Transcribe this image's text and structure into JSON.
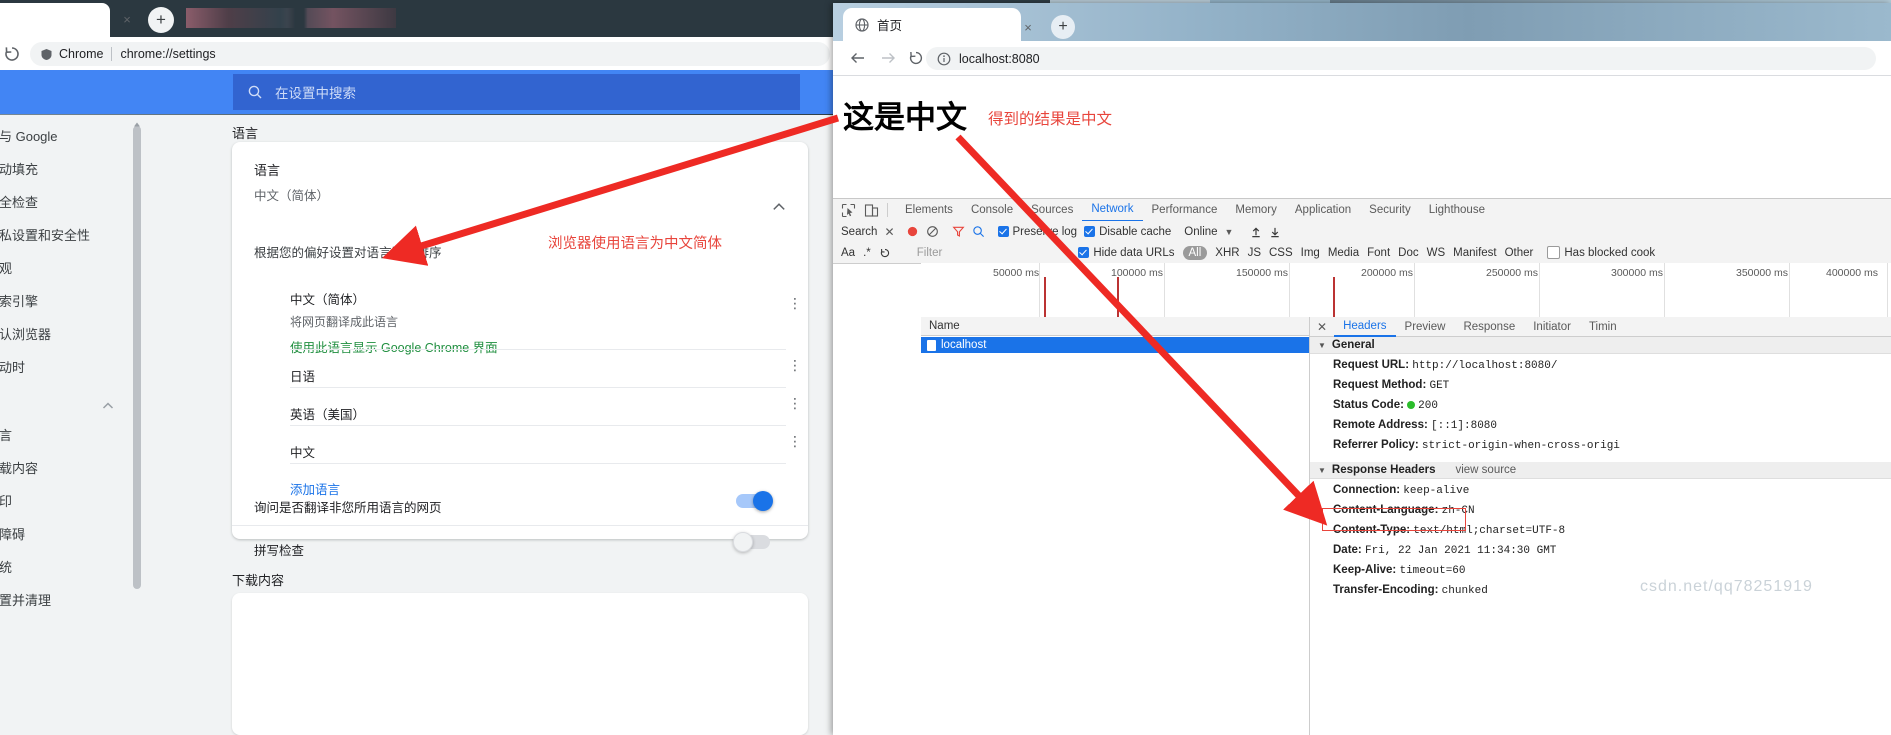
{
  "window_settings": {
    "tab": {
      "close_label": "×",
      "newtab_label": "+"
    },
    "toolbar": {
      "reload_icon": "reload-icon",
      "chip_label": "Chrome",
      "url": "chrome://settings"
    },
    "search": {
      "placeholder": "在设置中搜索",
      "icon": "search-icon"
    },
    "sidebar": {
      "items": [
        "您与 Google",
        "自动填充",
        "安全检查",
        "隐私设置和安全性",
        "外观",
        "搜索引擎",
        "默认浏览器",
        "启动时",
        "语言",
        "下载内容",
        "打印",
        "无障碍",
        "系统",
        "重置并清理"
      ]
    },
    "content": {
      "section_title": "语言",
      "section_title2": "下载内容",
      "card": {
        "title": "语言",
        "subtitle": "中文（简体）",
        "order_hint": "根据您的偏好设置对语言进行排序",
        "languages": [
          {
            "name": "中文（简体）",
            "sub": "将网页翻译成此语言",
            "alt": "使用此语言显示 Google Chrome 界面"
          },
          {
            "name": "日语",
            "sub": "",
            "alt": ""
          },
          {
            "name": "英语（美国）",
            "sub": "",
            "alt": ""
          },
          {
            "name": "中文",
            "sub": "",
            "alt": ""
          }
        ],
        "add_language": "添加语言",
        "translate_row": "询问是否翻译非您所用语言的网页",
        "spellcheck_row": "拼写检查",
        "translate_toggle": "on",
        "spellcheck_toggle": "off",
        "menu_icon": "kebab-menu-icon",
        "collapse_icon": "chevron-up-icon"
      }
    },
    "annotation": "浏览器使用语言为中文简体"
  },
  "window_devtools": {
    "tab": {
      "title": "首页",
      "favicon": "globe-icon",
      "close_label": "×",
      "newtab_label": "+"
    },
    "toolbar": {
      "back_icon": "arrow-left-icon",
      "forward_icon": "arrow-right-icon",
      "reload_icon": "reload-icon",
      "info_icon": "info-circle-icon",
      "url": "localhost:8080"
    },
    "page": {
      "heading": "这是中文",
      "annotation": "得到的结果是中文"
    },
    "devtools": {
      "inspect_icon": "cursor-inspect-icon",
      "device_icon": "device-toolbar-icon",
      "tabs": [
        "Elements",
        "Console",
        "Sources",
        "Network",
        "Performance",
        "Memory",
        "Application",
        "Security",
        "Lighthouse"
      ],
      "active_tab": "Network",
      "toolbar": {
        "search_label": "Search",
        "clear_label": "✕",
        "record_icon": "record-circle-icon",
        "clear_icon": "no-entry-icon",
        "filter_icon": "funnel-icon",
        "search_icon": "search-icon",
        "preserve_log": "Preserve log",
        "disable_cache": "Disable cache",
        "throttle": "Online",
        "import_icon": "import-arrow-icon",
        "export_icon": "export-arrow-icon"
      },
      "filterbar": {
        "aa_label": "Aa",
        "regex_label": ".*",
        "reload_icon": "reload-icon",
        "filter_placeholder": "Filter",
        "hide_data_urls": "Hide data URLs",
        "types": [
          "All",
          "XHR",
          "JS",
          "CSS",
          "Img",
          "Media",
          "Font",
          "Doc",
          "WS",
          "Manifest",
          "Other"
        ],
        "selected_type": "All",
        "blocked_cookies": "Has blocked cook"
      },
      "overview_ticks": [
        "50000 ms",
        "100000 ms",
        "150000 ms",
        "200000 ms",
        "250000 ms",
        "300000 ms",
        "350000 ms",
        "400000 ms"
      ],
      "requests": {
        "header": "Name",
        "rows": [
          {
            "name": "localhost",
            "selected": true
          }
        ]
      },
      "detail": {
        "tabs": [
          "Headers",
          "Preview",
          "Response",
          "Initiator",
          "Timin"
        ],
        "active_tab": "Headers",
        "close_label": "✕",
        "general": {
          "title": "General",
          "rows": [
            {
              "key": "Request URL:",
              "value": "http://localhost:8080/"
            },
            {
              "key": "Request Method:",
              "value": "GET"
            },
            {
              "key": "Status Code:",
              "value": "200"
            },
            {
              "key": "Remote Address:",
              "value": "[::1]:8080"
            },
            {
              "key": "Referrer Policy:",
              "value": "strict-origin-when-cross-origi"
            }
          ]
        },
        "response_headers": {
          "title": "Response Headers",
          "view_source": "view source",
          "rows": [
            {
              "key": "Connection:",
              "value": "keep-alive",
              "highlight": false
            },
            {
              "key": "Content-Language:",
              "value": "zh-CN",
              "highlight": true
            },
            {
              "key": "Content-Type:",
              "value": "text/html;charset=UTF-8",
              "highlight": false
            },
            {
              "key": "Date:",
              "value": "Fri, 22 Jan 2021 11:34:30 GMT",
              "highlight": false
            },
            {
              "key": "Keep-Alive:",
              "value": "timeout=60",
              "highlight": false
            },
            {
              "key": "Transfer-Encoding:",
              "value": "chunked",
              "highlight": false
            }
          ]
        }
      }
    }
  },
  "watermark": {
    "text": "csdn.net/qq78251919",
    "sub": ""
  },
  "colors": {
    "chrome_blue": "#4285f4",
    "annotation_red": "#e8453c",
    "link_blue": "#1a73e8",
    "green_link": "#1e8e3e",
    "status_green": "#2bbd2b"
  }
}
